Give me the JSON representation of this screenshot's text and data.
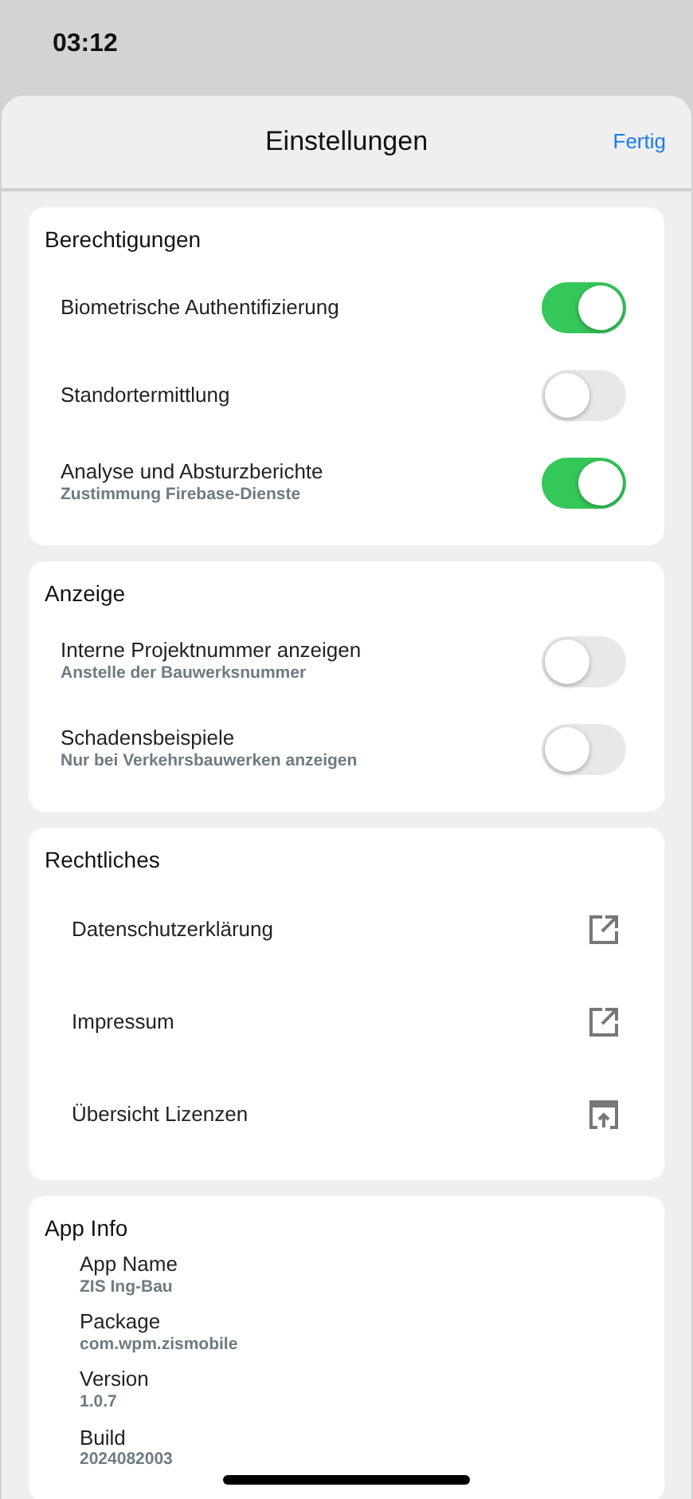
{
  "status_bar": {
    "time": "03:12"
  },
  "header": {
    "title": "Einstellungen",
    "done": "Fertig"
  },
  "sections": [
    {
      "kind": "toggles",
      "title": "Berechtigungen",
      "items": [
        {
          "label": "Biometrische Authentifizierung",
          "on": true
        },
        {
          "label": "Standortermittlung",
          "on": false
        },
        {
          "label": "Analyse und Absturzberichte",
          "sublabel": "Zustimmung Firebase-Dienste",
          "on": true
        }
      ]
    },
    {
      "kind": "toggles",
      "title": "Anzeige",
      "items": [
        {
          "label": "Interne Projektnummer anzeigen",
          "sublabel": "Anstelle der Bauwerksnummer",
          "on": false
        },
        {
          "label": "Schadensbeispiele",
          "sublabel": "Nur bei Verkehrsbauwerken anzeigen",
          "on": false
        }
      ]
    },
    {
      "kind": "links",
      "title": "Rechtliches",
      "items": [
        {
          "label": "Datenschutzerklärung",
          "kind": "external"
        },
        {
          "label": "Impressum",
          "kind": "external"
        },
        {
          "label": "Übersicht Lizenzen",
          "kind": "popup"
        }
      ]
    },
    {
      "kind": "info",
      "title": "App Info",
      "items": [
        {
          "label": "App Name",
          "value": "ZIS Ing-Bau"
        },
        {
          "label": "Package",
          "value": "com.wpm.zismobile"
        },
        {
          "label": "Version",
          "value": "1.0.7"
        },
        {
          "label": "Build",
          "value": "2024082003"
        }
      ]
    }
  ]
}
